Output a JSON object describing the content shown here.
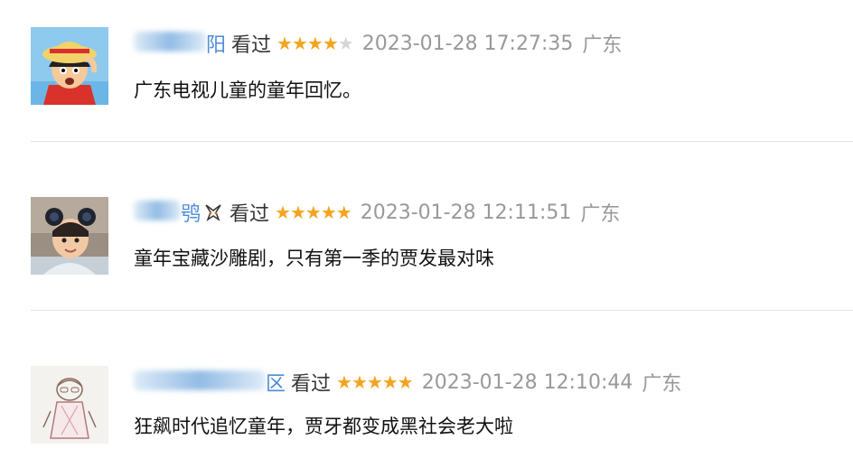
{
  "reviews": [
    {
      "avatar": "luffy-cartoon-avatar",
      "name_suffix": "阳",
      "action": "看过",
      "rating": 4,
      "max_rating": 5,
      "time": "2023-01-28 17:27:35",
      "location": "广东",
      "comment": "广东电视儿童的童年回忆。"
    },
    {
      "avatar": "child-photo-avatar",
      "name_suffix": "鸮",
      "action": "看过",
      "rating": 5,
      "max_rating": 5,
      "time": "2023-01-28 12:11:51",
      "location": "广东",
      "comment": "童年宝藏沙雕剧，只有第一季的贾发最对味"
    },
    {
      "avatar": "sketch-figure-avatar",
      "name_suffix": "区",
      "action": "看过",
      "rating": 5,
      "max_rating": 5,
      "time": "2023-01-28 12:10:44",
      "location": "广东",
      "comment": "狂飙时代追忆童年，贾牙都变成黑社会老大啦"
    }
  ],
  "colors": {
    "star": "#f3a41f",
    "star_empty": "#d7d7d7",
    "username": "#3b7dd8",
    "meta_gray": "#999999"
  }
}
